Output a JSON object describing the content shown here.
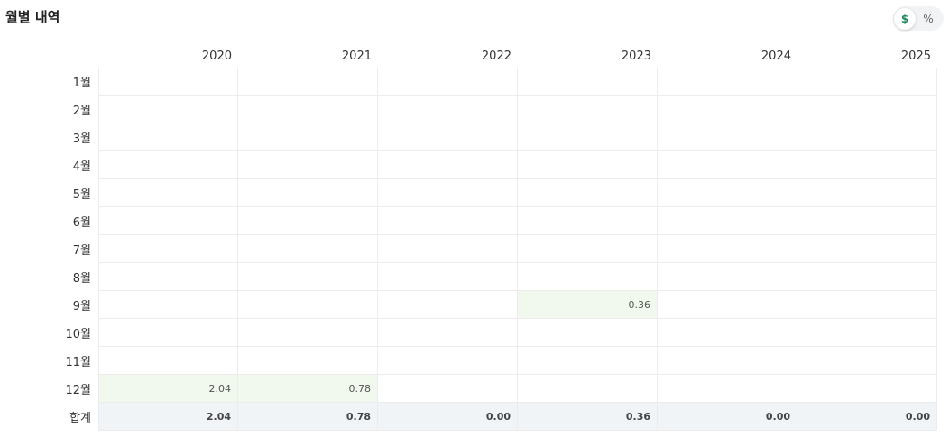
{
  "header": {
    "title": "월별 내역",
    "toggle": {
      "dollar_label": "$",
      "percent_label": "%",
      "selected": "$"
    }
  },
  "table": {
    "years": [
      "2020",
      "2021",
      "2022",
      "2023",
      "2024",
      "2025"
    ],
    "rows": [
      {
        "label": "1월",
        "values": [
          "",
          "",
          "",
          "",
          "",
          ""
        ]
      },
      {
        "label": "2월",
        "values": [
          "",
          "",
          "",
          "",
          "",
          ""
        ]
      },
      {
        "label": "3월",
        "values": [
          "",
          "",
          "",
          "",
          "",
          ""
        ]
      },
      {
        "label": "4월",
        "values": [
          "",
          "",
          "",
          "",
          "",
          ""
        ]
      },
      {
        "label": "5월",
        "values": [
          "",
          "",
          "",
          "",
          "",
          ""
        ]
      },
      {
        "label": "6월",
        "values": [
          "",
          "",
          "",
          "",
          "",
          ""
        ]
      },
      {
        "label": "7월",
        "values": [
          "",
          "",
          "",
          "",
          "",
          ""
        ]
      },
      {
        "label": "8월",
        "values": [
          "",
          "",
          "",
          "",
          "",
          ""
        ]
      },
      {
        "label": "9월",
        "values": [
          "",
          "",
          "",
          "0.36",
          "",
          ""
        ]
      },
      {
        "label": "10월",
        "values": [
          "",
          "",
          "",
          "",
          "",
          ""
        ]
      },
      {
        "label": "11월",
        "values": [
          "",
          "",
          "",
          "",
          "",
          ""
        ]
      },
      {
        "label": "12월",
        "values": [
          "2.04",
          "0.78",
          "",
          "",
          "",
          ""
        ]
      }
    ],
    "total": {
      "label": "합계",
      "values": [
        "2.04",
        "0.78",
        "0.00",
        "0.36",
        "0.00",
        "0.00"
      ]
    }
  },
  "colors": {
    "positive_bg": "#f1f9ee",
    "total_bg": "#f1f4f7",
    "accent": "#1f8a5b"
  }
}
